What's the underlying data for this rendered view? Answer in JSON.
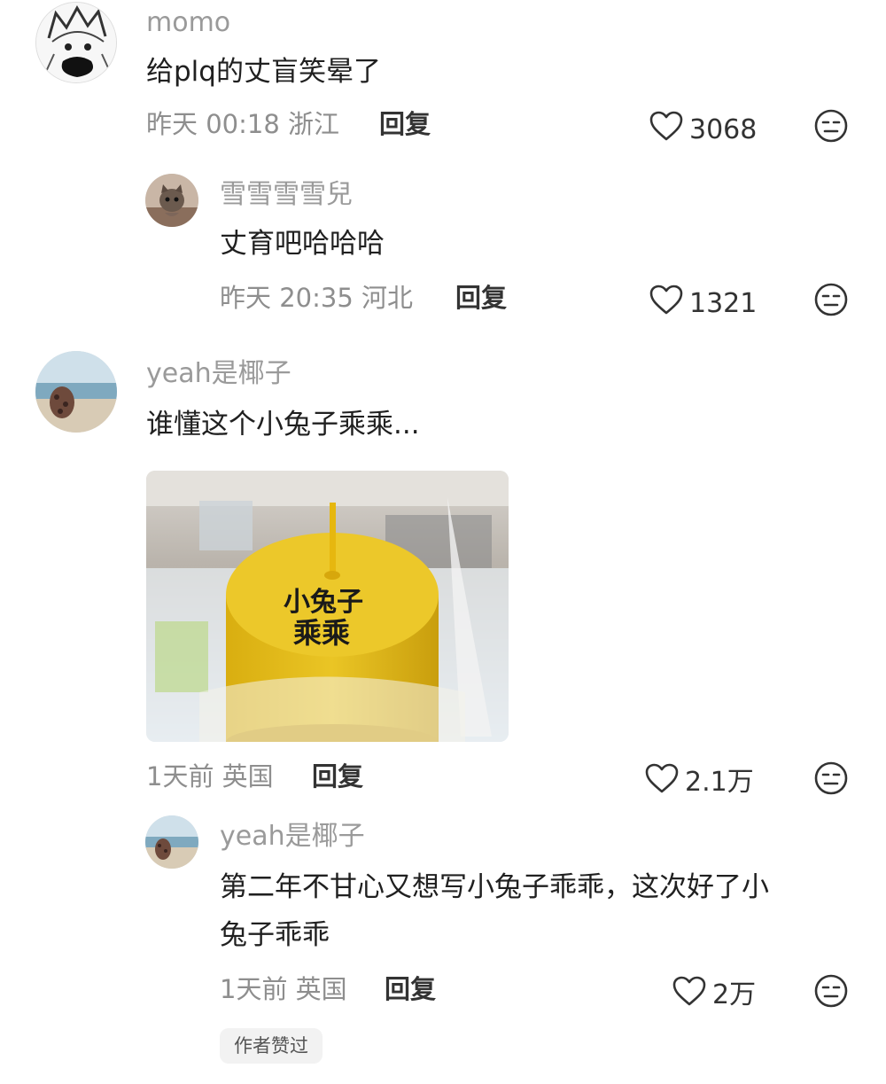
{
  "comments": [
    {
      "username": "momo",
      "text": "给plq的丈盲笑晕了",
      "time": "昨天 00:18",
      "location": "浙江",
      "reply_label": "回复",
      "likes": "3068"
    },
    {
      "username": "雪雪雪雪兒",
      "text": "丈育吧哈哈哈",
      "time": "昨天 20:35",
      "location": "河北",
      "reply_label": "回复",
      "likes": "1321"
    },
    {
      "username": "yeah是椰子",
      "text": "谁懂这个小兔子乘乘...",
      "time": "1天前",
      "location": "英国",
      "reply_label": "回复",
      "likes": "2.1万",
      "image": {
        "cake_line1": "小兔子",
        "cake_line2": "乘乘"
      }
    },
    {
      "username": "yeah是椰子",
      "text_line1": "第二年不甘心又想写小兔子乖乖，这次好了小",
      "text_line2": "兔子乖乖",
      "time": "1天前",
      "location": "英国",
      "reply_label": "回复",
      "likes": "2万",
      "badge": "作者赞过"
    }
  ],
  "icons": {
    "like": "heart-outline-icon",
    "emoji": "neutral-face-icon"
  },
  "colors": {
    "username": "#9a9a9a",
    "text": "#202020",
    "meta": "#8e8e8e",
    "cake": "#e8c21c"
  }
}
